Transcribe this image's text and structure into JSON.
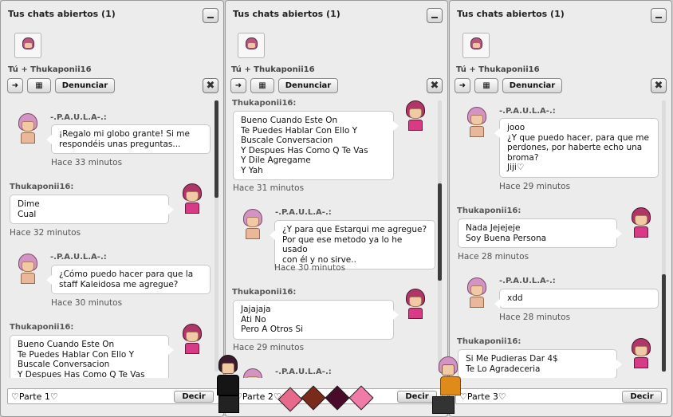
{
  "panels": [
    {
      "title": "Tus chats abiertos (1)",
      "conversation_label": "Tú + Thukaponii16",
      "report_label": "Denunciar",
      "input_value": "♡Parte 1♡",
      "send_label": "Decir",
      "messages": [
        {
          "sender": "-.P.A.U.L.A-.:",
          "text": "¡Regalo mi globo grante! Si me\nrespondéis unas preguntas...",
          "time": "Hace 33 minutos"
        },
        {
          "sender": "Thukaponii16:",
          "text": "Dime\nCual",
          "time": "Hace 32 minutos"
        },
        {
          "sender": "-.P.A.U.L.A-.:",
          "text": "¿Cómo puedo hacer para que la\nstaff Kaleidosa me agregue?",
          "time": "Hace 30 minutos"
        },
        {
          "sender": "Thukaponii16:",
          "text": "Bueno Cuando Este On\nTe Puedes Hablar Con Ello Y\nBuscale Conversacion\nY Despues Has Como Q Te Vas",
          "time": ""
        }
      ]
    },
    {
      "title": "Tus chats abiertos (1)",
      "conversation_label": "Tú + Thukaponii16",
      "report_label": "Denunciar",
      "input_value": "♡Parte 2♡",
      "send_label": "Decir",
      "messages": [
        {
          "sender": "Thukaponii16:",
          "text": "Bueno Cuando Este On\nTe Puedes Hablar Con Ello Y\nBuscale Conversacion\nY Despues Has Como Q Te Vas\nY Dile Agregame\nY Yah",
          "time": "Hace 31 minutos"
        },
        {
          "sender": "-.P.A.U.L.A-.:",
          "text": "¿Y para que Estarqui me agregue?\nPor que ese metodo ya lo he usado\ncon él y no sirve..",
          "time": "Hace 30 minutos"
        },
        {
          "sender": "Thukaponii16:",
          "text": "Jajajaja\nAti No\nPero A Otros Si",
          "time": "Hace 29 minutos"
        },
        {
          "sender": "-.P.A.U.L.A-.:",
          "text": "",
          "time": ""
        }
      ]
    },
    {
      "title": "Tus chats abiertos (1)",
      "conversation_label": "Tú + Thukaponii16",
      "report_label": "Denunciar",
      "input_value": "♡Parte 3♡",
      "send_label": "Decir",
      "messages": [
        {
          "sender": "-.P.A.U.L.A-.:",
          "text": "jooo\n¿Y que puedo hacer, para que me\nperdones, por haberte echo una\nbroma?\nJiji♡",
          "time": "Hace 29 minutos"
        },
        {
          "sender": "Thukaponii16:",
          "text": "Nada Jejejeje\nSoy Buena Persona",
          "time": "Hace 28 minutos"
        },
        {
          "sender": "-.P.A.U.L.A-.:",
          "text": "xdd",
          "time": "Hace 28 minutos"
        },
        {
          "sender": "Thukaponii16:",
          "text": "Si Me Pudieras Dar 4$\nTe Lo Agradeceria",
          "time": ""
        }
      ]
    }
  ],
  "colors": {
    "panel_bg": "#ececec",
    "bubble_bg": "#ffffff",
    "scroll_thumb": "#3c3c3c"
  }
}
